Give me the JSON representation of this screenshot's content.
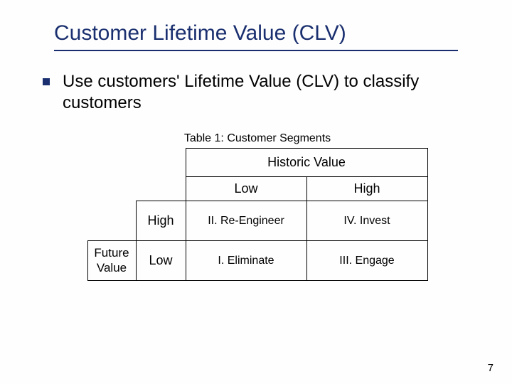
{
  "title": "Customer Lifetime Value (CLV)",
  "bullet": "Use customers' Lifetime Value (CLV) to classify customers",
  "table": {
    "caption": "Table 1: Customer Segments",
    "col_header": "Historic Value",
    "row_header": "Future Value",
    "cols": {
      "low": "Low",
      "high": "High"
    },
    "rows": {
      "high": "High",
      "low": "Low"
    },
    "cells": {
      "high_low": "II. Re-Engineer",
      "high_high": "IV. Invest",
      "low_low": "I. Eliminate",
      "low_high": "III. Engage"
    }
  },
  "page_number": "7",
  "chart_data": {
    "type": "table",
    "title": "Table 1: Customer Segments",
    "row_dimension": "Future Value",
    "col_dimension": "Historic Value",
    "rows": [
      "High",
      "Low"
    ],
    "cols": [
      "Low",
      "High"
    ],
    "values": [
      [
        "II. Re-Engineer",
        "IV. Invest"
      ],
      [
        "I. Eliminate",
        "III. Engage"
      ]
    ]
  }
}
